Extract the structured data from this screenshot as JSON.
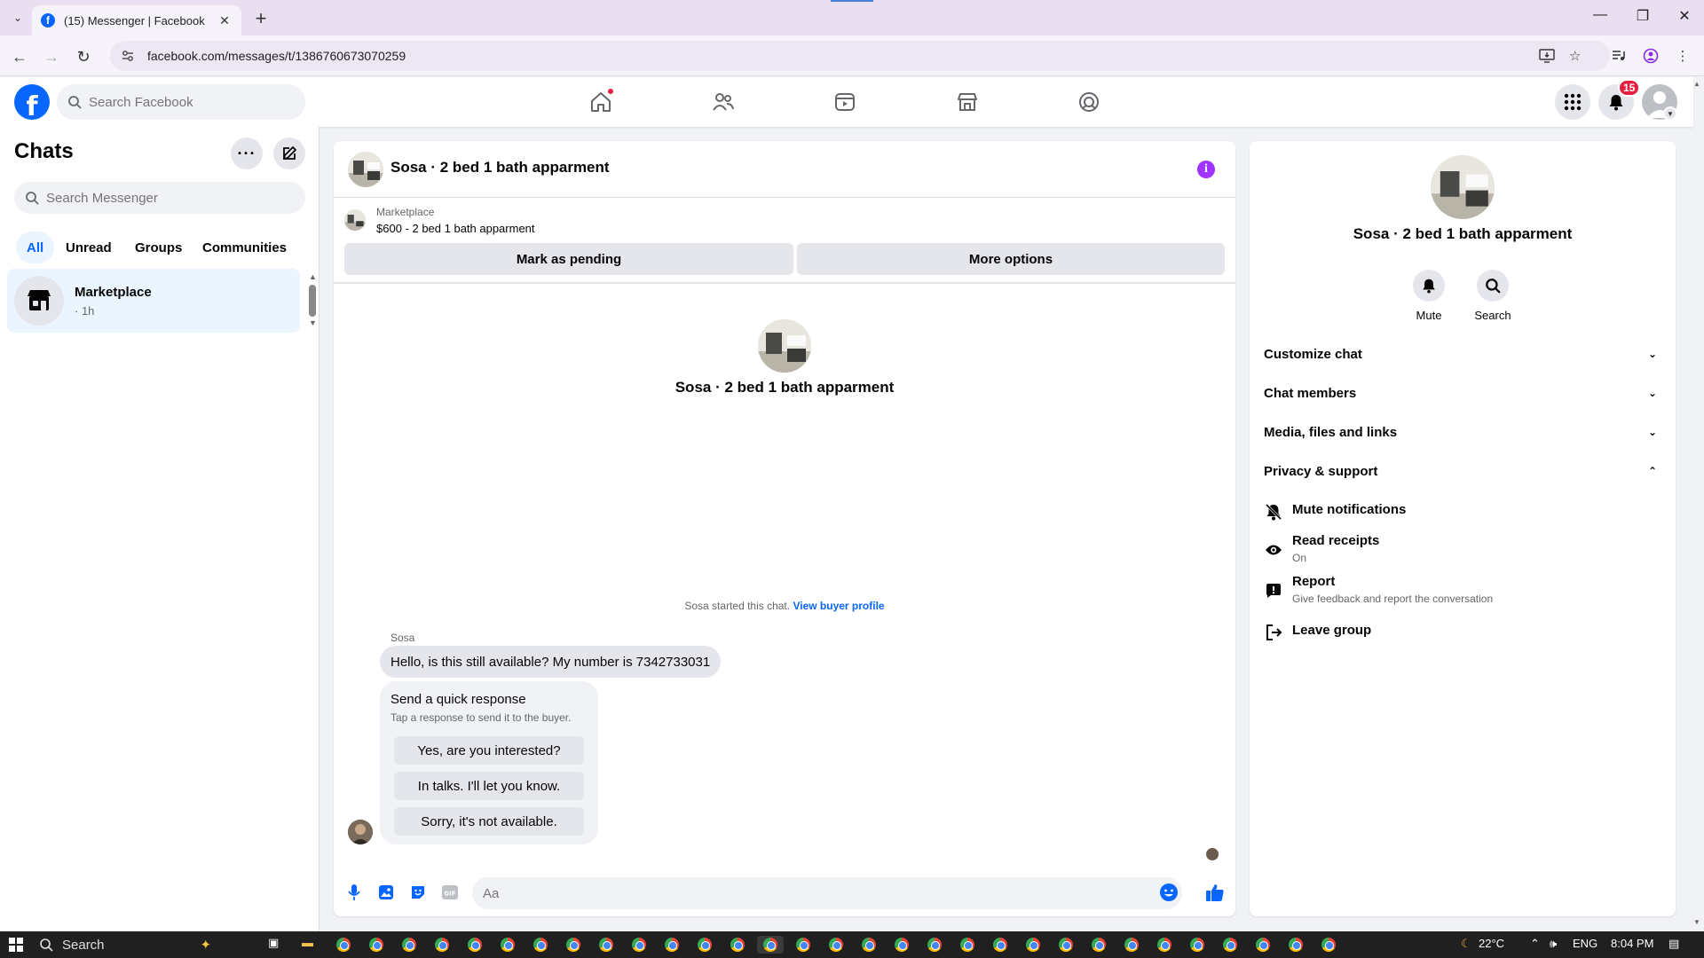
{
  "browser": {
    "tab_title": "(15) Messenger | Facebook",
    "url": "facebook.com/messages/t/1386760673070259"
  },
  "facebook": {
    "search_placeholder": "Search Facebook",
    "notifications_count": "15"
  },
  "chats_panel": {
    "title": "Chats",
    "search_placeholder": "Search Messenger",
    "filters": [
      "All",
      "Unread",
      "Groups",
      "Communities"
    ],
    "active_filter": "All",
    "chats": [
      {
        "name": "Marketplace",
        "time": "· 1h"
      }
    ]
  },
  "conversation": {
    "title": "Sosa · 2 bed 1 bath apparment",
    "marketplace_label": "Marketplace",
    "listing": "$600 - 2 bed 1 bath apparment",
    "mark_pending": "Mark as pending",
    "more_options": "More options",
    "intro_name": "Sosa · 2 bed 1 bath apparment",
    "started_text": "Sosa started this chat.",
    "view_buyer_profile": "View buyer profile",
    "sender": "Sosa",
    "message": "Hello, is this still available? My number is 7342733031",
    "quick_title": "Send a quick response",
    "quick_sub": "Tap a response to send it to the buyer.",
    "quick_responses": [
      "Yes, are you interested?",
      "In talks. I'll let you know.",
      "Sorry, it's not available."
    ],
    "composer_placeholder": "Aa"
  },
  "details_panel": {
    "name": "Sosa · 2 bed 1 bath apparment",
    "mute_label": "Mute",
    "search_label": "Search",
    "sections": [
      "Customize chat",
      "Chat members",
      "Media, files and links",
      "Privacy & support"
    ],
    "options": {
      "mute_notifications": "Mute notifications",
      "read_receipts": "Read receipts",
      "read_receipts_status": "On",
      "report": "Report",
      "report_sub": "Give feedback and report the conversation",
      "leave_group": "Leave group"
    }
  },
  "taskbar": {
    "search_label": "Search",
    "temperature": "22°C",
    "language": "ENG",
    "time": "8:04 PM"
  },
  "colors": {
    "brand_blue": "#0866ff",
    "info_purple": "#a033ff",
    "badge_red": "#e41e3f"
  }
}
